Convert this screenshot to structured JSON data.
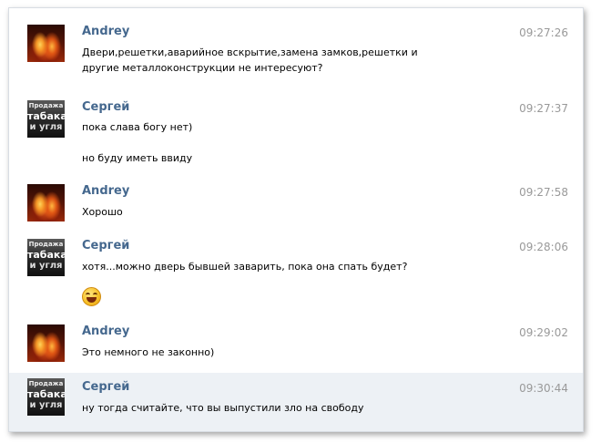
{
  "messages": [
    {
      "author": "Andrey",
      "time": "09:27:26",
      "avatar_icon": "fire-avatar",
      "lines": [
        "Двери,решетки,аварийное вскрытие,замена замков,решетки и",
        "другие металлоконструкции не интересуют?"
      ]
    },
    {
      "author": "Сергей",
      "time": "09:27:37",
      "avatar_icon": "tobacco-avatar",
      "avatar_text": [
        "Продажа",
        "табака",
        "и угля"
      ],
      "lines": [
        "пока слава богу нет)"
      ],
      "extra_line": "но буду иметь ввиду"
    },
    {
      "author": "Andrey",
      "time": "09:27:58",
      "avatar_icon": "fire-avatar",
      "lines": [
        "Хорошо"
      ]
    },
    {
      "author": "Сергей",
      "time": "09:28:06",
      "avatar_icon": "tobacco-avatar",
      "avatar_text": [
        "Продажа",
        "табака",
        "и угля"
      ],
      "lines": [
        "хотя...можно дверь бывшей заварить, пока она спать будет?"
      ],
      "emoji": "laughing-smiley-icon"
    },
    {
      "author": "Andrey",
      "time": "09:29:02",
      "avatar_icon": "fire-avatar",
      "lines": [
        "Это немного не законно)"
      ]
    },
    {
      "author": "Сергей",
      "time": "09:30:44",
      "avatar_icon": "tobacco-avatar",
      "avatar_text": [
        "Продажа",
        "табака",
        "и угля"
      ],
      "lines": [
        "ну тогда считайте, что вы выпустили зло на свободу"
      ],
      "highlighted": true
    }
  ],
  "colors": {
    "author": "#45688e",
    "time": "#999999",
    "highlight_bg": "#edf1f5"
  }
}
